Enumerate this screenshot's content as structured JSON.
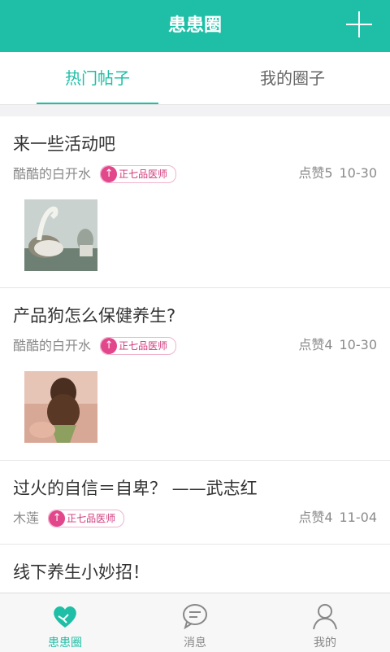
{
  "header": {
    "title": "患患圈"
  },
  "tabs": [
    {
      "label": "热门帖子",
      "active": true
    },
    {
      "label": "我的圈子",
      "active": false
    }
  ],
  "posts": [
    {
      "title": "来一些活动吧",
      "author": "酷酷的白开水",
      "badge": "正七品医师",
      "likes": "点赞5",
      "date": "10-30",
      "has_image": true
    },
    {
      "title": "产品狗怎么保健养生?",
      "author": "酷酷的白开水",
      "badge": "正七品医师",
      "likes": "点赞4",
      "date": "10-30",
      "has_image": true
    },
    {
      "title": "过火的自信＝自卑？ ——武志红",
      "author": "木莲",
      "badge": "正七品医师",
      "likes": "点赞4",
      "date": "11-04",
      "has_image": false
    },
    {
      "title": "线下养生小妙招！",
      "author": "",
      "badge": "",
      "likes": "",
      "date": "",
      "has_image": false
    }
  ],
  "bottom_nav": [
    {
      "label": "患患圈",
      "icon": "handshake-heart-icon",
      "active": true
    },
    {
      "label": "消息",
      "icon": "chat-bubble-icon",
      "active": false
    },
    {
      "label": "我的",
      "icon": "person-icon",
      "active": false
    }
  ],
  "colors": {
    "accent": "#1ebfa6",
    "badge": "#e2468b"
  }
}
